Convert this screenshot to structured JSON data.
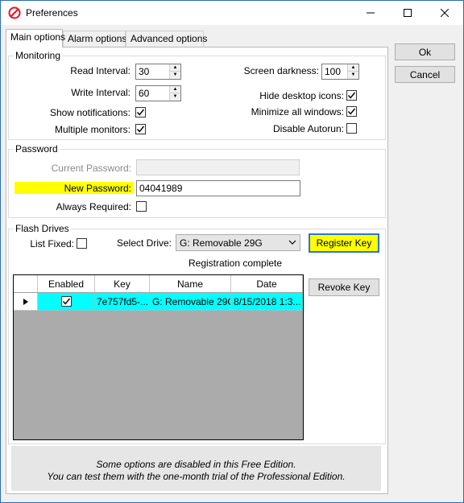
{
  "window": {
    "title": "Preferences"
  },
  "tabs": [
    "Main options",
    "Alarm options",
    "Advanced options"
  ],
  "monitoring": {
    "legend": "Monitoring",
    "read_interval_label": "Read Interval:",
    "read_interval_value": "30",
    "write_interval_label": "Write Interval:",
    "write_interval_value": "60",
    "show_notifications_label": "Show notifications:",
    "show_notifications_checked": true,
    "multiple_monitors_label": "Multiple monitors:",
    "multiple_monitors_checked": true,
    "screen_darkness_label": "Screen darkness:",
    "screen_darkness_value": "100",
    "hide_desktop_icons_label": "Hide desktop icons:",
    "hide_desktop_icons_checked": true,
    "minimize_all_windows_label": "Minimize all windows:",
    "minimize_all_windows_checked": true,
    "disable_autorun_label": "Disable Autorun:",
    "disable_autorun_checked": false
  },
  "password": {
    "legend": "Password",
    "current_label": "Current Password:",
    "current_value": "",
    "new_label": "New Password:",
    "new_value": "04041989",
    "always_required_label": "Always Required:",
    "always_required_checked": false
  },
  "flash_drives": {
    "legend": "Flash Drives",
    "list_fixed_label": "List Fixed:",
    "list_fixed_checked": false,
    "select_drive_label": "Select Drive:",
    "select_drive_value": "G: Removable 29G",
    "register_key_label": "Register Key",
    "status_text": "Registration complete",
    "revoke_key_label": "Revoke Key",
    "columns": [
      "Enabled",
      "Key",
      "Name",
      "Date"
    ],
    "rows": [
      {
        "enabled": true,
        "key": "7e757fd5-...",
        "name": "G: Removable 29G",
        "date": "8/15/2018 1:3..."
      }
    ]
  },
  "buttons": {
    "ok": "Ok",
    "cancel": "Cancel"
  },
  "info": {
    "line1": "Some options are disabled in this Free Edition.",
    "line2": "You can test them with the one-month trial of the Professional Edition."
  },
  "colors": {
    "highlight": "#ffff00",
    "selected_row": "#00ffff",
    "app_icon": "#e81123"
  }
}
